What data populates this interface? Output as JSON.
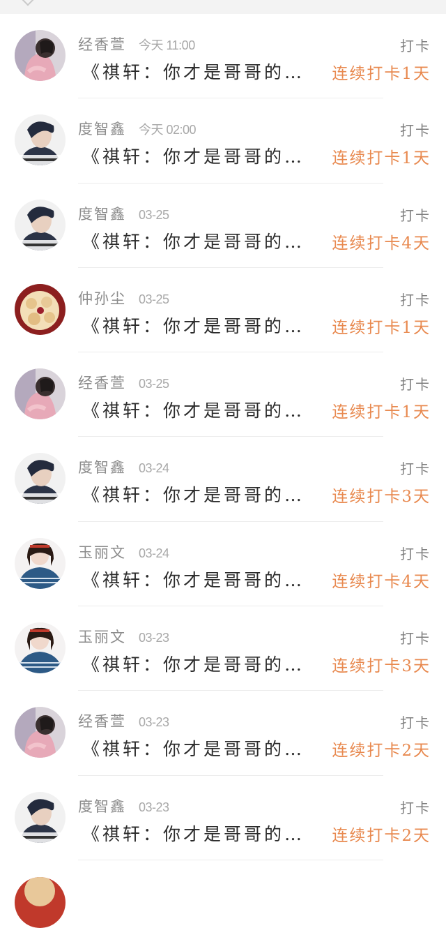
{
  "rows": [
    {
      "author": "经香萱",
      "time": "今天 11:00",
      "title": "《祺轩：你才是哥哥的救赎》",
      "action": "打卡",
      "streak": "连续打卡1天",
      "avatar": "pink-hoodie-girl"
    },
    {
      "author": "度智鑫",
      "time": "今天 02:00",
      "title": "《祺轩：你才是哥哥的救赎》",
      "action": "打卡",
      "streak": "连续打卡1天",
      "avatar": "boy-portrait"
    },
    {
      "author": "度智鑫",
      "time": "03-25",
      "title": "《祺轩：你才是哥哥的救赎》",
      "action": "打卡",
      "streak": "连续打卡4天",
      "avatar": "boy-portrait"
    },
    {
      "author": "仲孙尘",
      "time": "03-25",
      "title": "《祺轩：你才是哥哥的救赎》",
      "action": "打卡",
      "streak": "连续打卡1天",
      "avatar": "food-plate"
    },
    {
      "author": "经香萱",
      "time": "03-25",
      "title": "《祺轩：你才是哥哥的救赎》",
      "action": "打卡",
      "streak": "连续打卡1天",
      "avatar": "pink-hoodie-girl"
    },
    {
      "author": "度智鑫",
      "time": "03-24",
      "title": "《祺轩：你才是哥哥的救赎》",
      "action": "打卡",
      "streak": "连续打卡3天",
      "avatar": "boy-portrait"
    },
    {
      "author": "玉丽文",
      "time": "03-24",
      "title": "《祺轩：你才是哥哥的救赎》",
      "action": "打卡",
      "streak": "连续打卡4天",
      "avatar": "girl-blue-sweater"
    },
    {
      "author": "玉丽文",
      "time": "03-23",
      "title": "《祺轩：你才是哥哥的救赎》",
      "action": "打卡",
      "streak": "连续打卡3天",
      "avatar": "girl-blue-sweater"
    },
    {
      "author": "经香萱",
      "time": "03-23",
      "title": "《祺轩：你才是哥哥的救赎》",
      "action": "打卡",
      "streak": "连续打卡2天",
      "avatar": "pink-hoodie-girl"
    },
    {
      "author": "度智鑫",
      "time": "03-23",
      "title": "《祺轩：你才是哥哥的救赎》",
      "action": "打卡",
      "streak": "连续打卡2天",
      "avatar": "boy-portrait"
    }
  ],
  "colors": {
    "streak": "#e8894f",
    "author": "#8c8c8c",
    "title": "#2b2b2b",
    "action": "#7f7f7f"
  }
}
